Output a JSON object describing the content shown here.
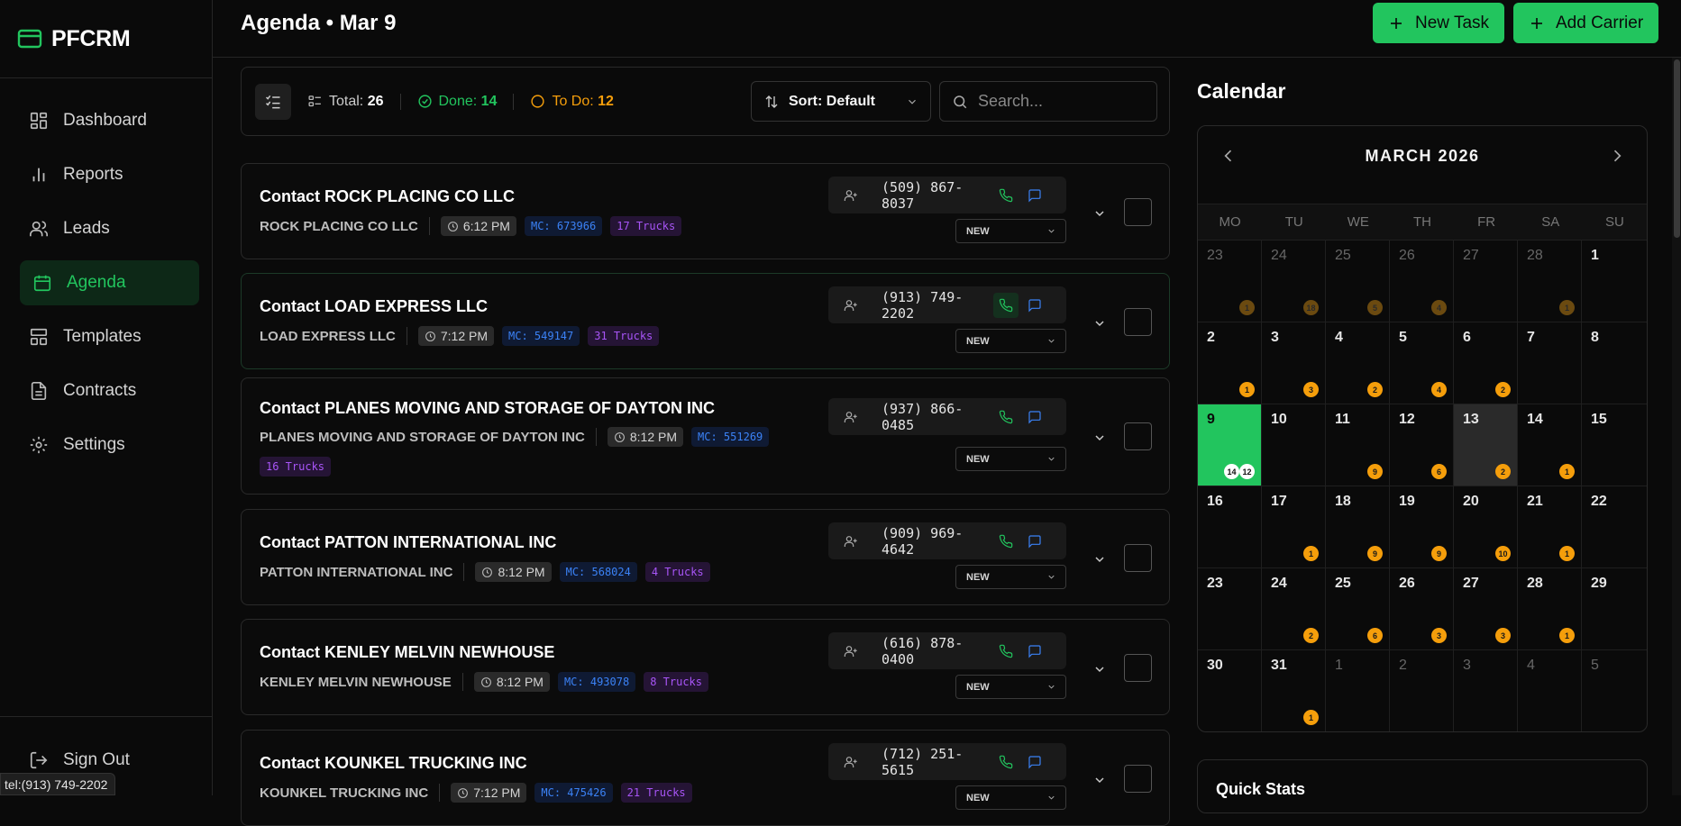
{
  "app": {
    "name": "PFCRM"
  },
  "sidebar": {
    "items": [
      {
        "label": "Dashboard",
        "icon": "dashboard-icon"
      },
      {
        "label": "Reports",
        "icon": "bar-chart-icon"
      },
      {
        "label": "Leads",
        "icon": "users-icon"
      },
      {
        "label": "Agenda",
        "icon": "calendar-icon",
        "active": true
      },
      {
        "label": "Templates",
        "icon": "layout-icon"
      },
      {
        "label": "Contracts",
        "icon": "document-icon"
      },
      {
        "label": "Settings",
        "icon": "gear-icon"
      }
    ],
    "signout": "Sign Out"
  },
  "header": {
    "title": "Agenda • Mar 9",
    "new_task": "New Task",
    "add_carrier": "Add Carrier"
  },
  "toolbar": {
    "total_label": "Total:",
    "total_value": "26",
    "done_label": "Done:",
    "done_value": "14",
    "todo_label": "To Do:",
    "todo_value": "12",
    "sort_label": "Sort: Default",
    "search_placeholder": "Search..."
  },
  "tasks": [
    {
      "title": "Contact ROCK PLACING CO LLC",
      "company": "ROCK PLACING CO LLC",
      "time": "6:12 PM",
      "mc": "MC: 673966",
      "trucks": "17 Trucks",
      "phone": "(509) 867-8037",
      "status": "NEW"
    },
    {
      "title": "Contact LOAD EXPRESS LLC",
      "company": "LOAD EXPRESS LLC",
      "time": "7:12 PM",
      "mc": "MC: 549147",
      "trucks": "31 Trucks",
      "phone": "(913) 749-2202",
      "status": "NEW"
    },
    {
      "title": "Contact PLANES MOVING AND STORAGE OF DAYTON INC",
      "company": "PLANES MOVING AND STORAGE OF DAYTON INC",
      "time": "8:12 PM",
      "mc": "MC: 551269",
      "trucks": "16 Trucks",
      "phone": "(937) 866-0485",
      "status": "NEW"
    },
    {
      "title": "Contact PATTON INTERNATIONAL INC",
      "company": "PATTON INTERNATIONAL INC",
      "time": "8:12 PM",
      "mc": "MC: 568024",
      "trucks": "4 Trucks",
      "phone": "(909) 969-4642",
      "status": "NEW"
    },
    {
      "title": "Contact KENLEY MELVIN NEWHOUSE",
      "company": "KENLEY MELVIN NEWHOUSE",
      "time": "8:12 PM",
      "mc": "MC: 493078",
      "trucks": "8 Trucks",
      "phone": "(616) 878-0400",
      "status": "NEW"
    },
    {
      "title": "Contact KOUNKEL TRUCKING INC",
      "company": "KOUNKEL TRUCKING INC",
      "time": "7:12 PM",
      "mc": "MC: 475426",
      "trucks": "21 Trucks",
      "phone": "(712) 251-5615",
      "status": "NEW"
    }
  ],
  "calendar": {
    "title": "Calendar",
    "month": "MARCH 2026",
    "weekdays": [
      "MO",
      "TU",
      "WE",
      "TH",
      "FR",
      "SA",
      "SU"
    ],
    "days": [
      {
        "d": "23",
        "dim": true,
        "dots": [
          "1"
        ],
        "faded": true
      },
      {
        "d": "24",
        "dim": true,
        "dots": [
          "18"
        ],
        "faded": true
      },
      {
        "d": "25",
        "dim": true,
        "dots": [
          "5"
        ],
        "faded": true
      },
      {
        "d": "26",
        "dim": true,
        "dots": [
          "4"
        ],
        "faded": true
      },
      {
        "d": "27",
        "dim": true,
        "dots": []
      },
      {
        "d": "28",
        "dim": true,
        "dots": [
          "1"
        ],
        "faded": true
      },
      {
        "d": "1",
        "dots": []
      },
      {
        "d": "2",
        "dots": [
          "1"
        ]
      },
      {
        "d": "3",
        "dots": [
          "3"
        ]
      },
      {
        "d": "4",
        "dots": [
          "2"
        ]
      },
      {
        "d": "5",
        "dots": [
          "4"
        ]
      },
      {
        "d": "6",
        "dots": [
          "2"
        ]
      },
      {
        "d": "7",
        "dots": []
      },
      {
        "d": "8",
        "dots": []
      },
      {
        "d": "9",
        "today": true,
        "dots": [
          "14",
          "12"
        ]
      },
      {
        "d": "10",
        "dots": []
      },
      {
        "d": "11",
        "dots": [
          "9"
        ]
      },
      {
        "d": "12",
        "dots": [
          "6"
        ]
      },
      {
        "d": "13",
        "sel": true,
        "dots": [
          "2"
        ]
      },
      {
        "d": "14",
        "dots": [
          "1"
        ]
      },
      {
        "d": "15",
        "dots": []
      },
      {
        "d": "16",
        "dots": []
      },
      {
        "d": "17",
        "dots": [
          "1"
        ]
      },
      {
        "d": "18",
        "dots": [
          "9"
        ]
      },
      {
        "d": "19",
        "dots": [
          "9"
        ]
      },
      {
        "d": "20",
        "dots": [
          "10"
        ]
      },
      {
        "d": "21",
        "dots": [
          "1"
        ]
      },
      {
        "d": "22",
        "dots": []
      },
      {
        "d": "23",
        "dots": []
      },
      {
        "d": "24",
        "dots": [
          "2"
        ]
      },
      {
        "d": "25",
        "dots": [
          "6"
        ]
      },
      {
        "d": "26",
        "dots": [
          "3"
        ]
      },
      {
        "d": "27",
        "dots": [
          "3"
        ]
      },
      {
        "d": "28",
        "dots": [
          "1"
        ]
      },
      {
        "d": "29",
        "dots": []
      },
      {
        "d": "30",
        "dots": []
      },
      {
        "d": "31",
        "dots": [
          "1"
        ]
      },
      {
        "d": "1",
        "dim": true,
        "dots": []
      },
      {
        "d": "2",
        "dim": true,
        "dots": []
      },
      {
        "d": "3",
        "dim": true,
        "dots": []
      },
      {
        "d": "4",
        "dim": true,
        "dots": []
      },
      {
        "d": "5",
        "dim": true,
        "dots": []
      }
    ]
  },
  "quick_stats": {
    "title": "Quick Stats"
  },
  "status_bar": {
    "link": "tel:(913) 749-2202"
  },
  "colors": {
    "accent": "#22c55e",
    "background": "#0a0a0a",
    "done": "#22c55e",
    "todo": "#f59e0b",
    "mc": "#3b82f6",
    "trucks": "#a855f7"
  }
}
